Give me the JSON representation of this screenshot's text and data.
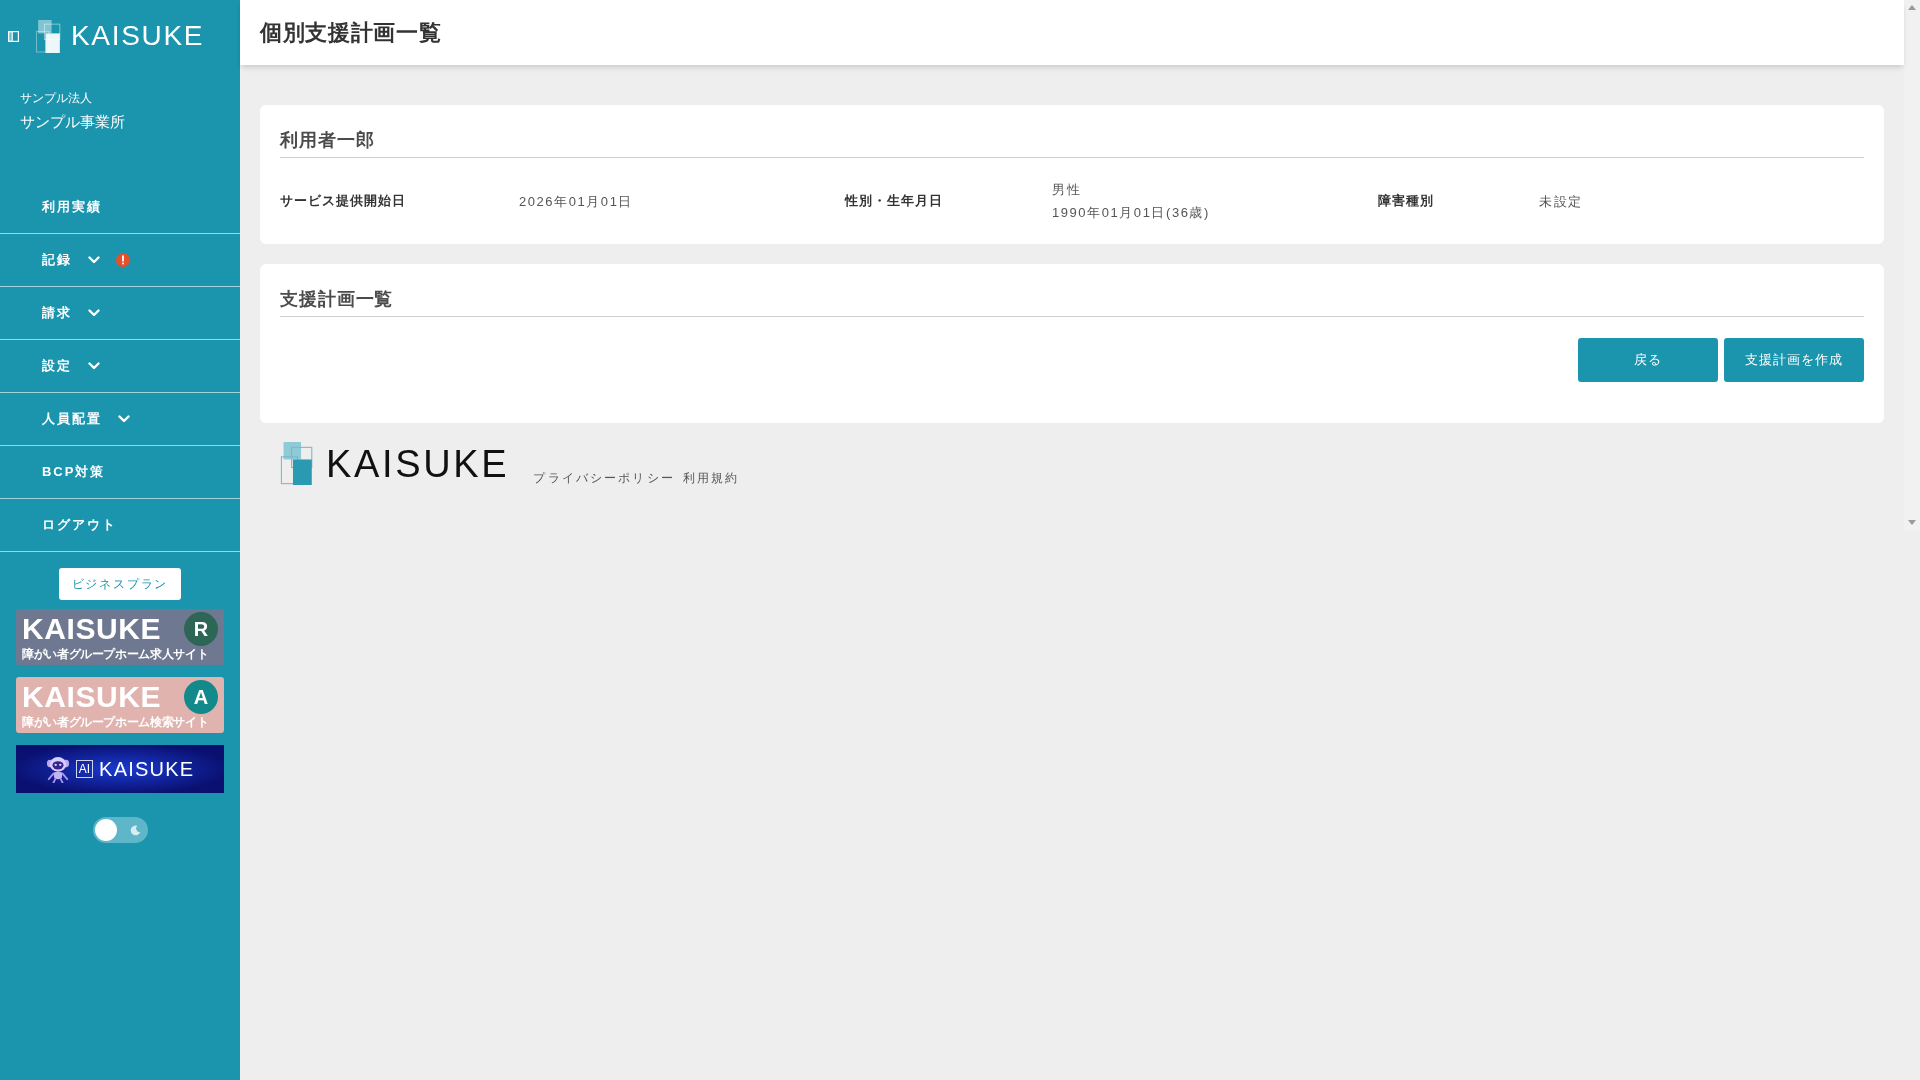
{
  "sidebar": {
    "logo": "KAISUKE",
    "organization": "サンプル法人",
    "office": "サンプル事業所",
    "nav_items": [
      {
        "label": "利用実績",
        "kind": "link",
        "alert": false
      },
      {
        "label": "記録",
        "kind": "menu",
        "expanded": false,
        "alert": true
      },
      {
        "label": "請求",
        "kind": "menu",
        "expanded": false,
        "alert": false
      },
      {
        "label": "設定",
        "kind": "menu",
        "expanded": false,
        "alert": false
      },
      {
        "label": "人員配置",
        "kind": "menu",
        "expanded": false,
        "alert": false
      },
      {
        "label": "BCP対策",
        "kind": "link",
        "alert": false
      },
      {
        "label": "ログアウト",
        "kind": "link",
        "alert": false
      }
    ],
    "plan_badge": "ビジネスプラン",
    "banners": [
      {
        "kind": "recruit",
        "title": "KAISUKE",
        "subtitle": "障がい者グループホーム求人サイト",
        "letter": "R"
      },
      {
        "kind": "search",
        "title": "KAISUKE",
        "subtitle": "障がい者グループホーム検索サイト",
        "letter": "A"
      },
      {
        "kind": "ai",
        "title": "KAISUKE",
        "tag": "AI"
      }
    ],
    "dark_mode_toggle": {
      "on": false
    }
  },
  "header": {
    "title": "個別支援計画一覧"
  },
  "user_card": {
    "name": "利用者一郎",
    "fields": [
      {
        "label": "サービス提供開始日",
        "values": [
          "2026年01月01日"
        ]
      },
      {
        "label": "性別・生年月日",
        "values": [
          "男性",
          "1990年01月01日(36歳)"
        ]
      },
      {
        "label": "障害種別",
        "values": [
          "未設定"
        ]
      }
    ]
  },
  "plans_card": {
    "title": "支援計画一覧",
    "buttons": [
      {
        "label": "戻る"
      },
      {
        "label": "支援計画を作成"
      }
    ]
  },
  "footer": {
    "logo": "KAISUKE",
    "links": [
      "プライバシーポリシー",
      "利用規約"
    ]
  }
}
